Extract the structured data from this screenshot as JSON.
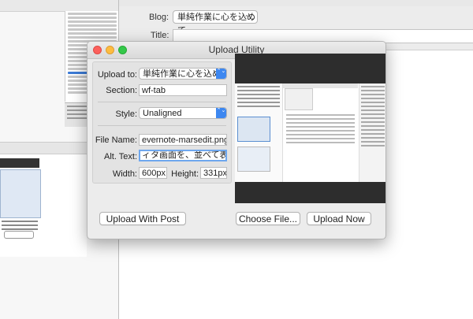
{
  "main_window": {
    "blog_label": "Blog:",
    "blog_value": "単純作業に心を込めて",
    "title_label": "Title:"
  },
  "upload_utility": {
    "title": "Upload Utility",
    "upload_to_label": "Upload to:",
    "upload_to_value": "単純作業に心を込めて",
    "section_label": "Section:",
    "section_value": "wf-tab",
    "style_label": "Style:",
    "style_value": "Unaligned",
    "file_name_label": "File Name:",
    "file_name_value": "evernote-marsedit.png",
    "alt_text_label": "Alt. Text:",
    "alt_text_value": "ィタ画面を、並べて表示する",
    "width_label": "Width:",
    "width_value": "600px",
    "height_label": "Height:",
    "height_value": "331px",
    "buttons": {
      "upload_with_post": "Upload With Post",
      "choose_file": "Choose File...",
      "upload_now": "Upload Now"
    }
  },
  "icons": {
    "popup_arrows": "⌃⌄",
    "close": "close-icon",
    "minimize": "minimize-icon",
    "zoom": "zoom-icon"
  },
  "colors": {
    "accent_blue": "#3d87f0",
    "focus_ring": "#6ea7ee",
    "close_red": "#fc605c",
    "minimize_yellow": "#fdbc40",
    "zoom_green": "#34c84a"
  }
}
